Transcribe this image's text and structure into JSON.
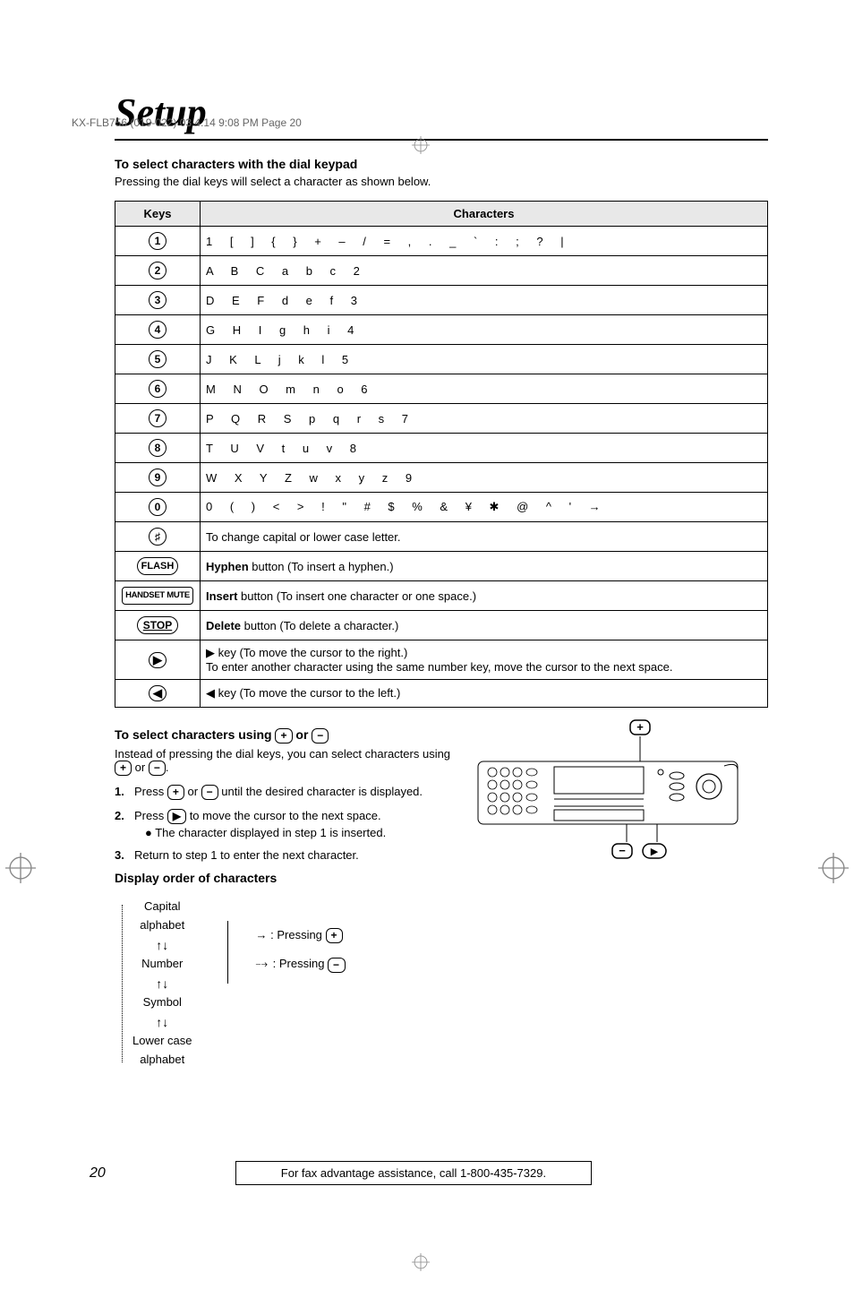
{
  "header": {
    "doc_id": "KX-FLB756 (019-022)  03.4.14  9:08 PM  Page 20"
  },
  "title": "Setup",
  "keypad_section": {
    "heading": "To select characters with the dial keypad",
    "subtext": "Pressing the dial keys will select a character as shown below.",
    "col_keys": "Keys",
    "col_chars": "Characters",
    "rows": [
      {
        "key": "1",
        "chars": "1 [ ] { } + – / = , . _ ` : ; ? |"
      },
      {
        "key": "2",
        "chars": "A B C a b c 2"
      },
      {
        "key": "3",
        "chars": "D E F d e f 3"
      },
      {
        "key": "4",
        "chars": "G H I g h i 4"
      },
      {
        "key": "5",
        "chars": "J K L j k l 5"
      },
      {
        "key": "6",
        "chars": "M N O m n o 6"
      },
      {
        "key": "7",
        "chars": "P Q R S p q r s 7"
      },
      {
        "key": "8",
        "chars": "T U V t u v 8"
      },
      {
        "key": "9",
        "chars": "W X Y Z w x y z 9"
      },
      {
        "key": "0",
        "chars": "0 ( ) < > ! \" # $ % & ¥ ✱ @ ^ ' →"
      }
    ],
    "hash_desc": "To change capital or lower case letter.",
    "flash_label": "FLASH",
    "flash_desc_bold": "Hyphen",
    "flash_desc_rest": " button (To insert a hyphen.)",
    "handset_label": "HANDSET MUTE",
    "handset_desc_bold": "Insert",
    "handset_desc_rest": " button (To insert one character or one space.)",
    "stop_label": "STOP",
    "stop_desc_bold": "Delete",
    "stop_desc_rest": " button (To delete a character.)",
    "right_desc_line1": "▶ key (To move the cursor to the right.)",
    "right_desc_line2": "To enter another character using the same number key, move the cursor to the next space.",
    "left_desc": "◀ key (To move the cursor to the left.)"
  },
  "plusminus_section": {
    "heading_prefix": "To select characters using ",
    "heading_mid": " or ",
    "intro_prefix": "Instead of pressing the dial keys, you can select characters using ",
    "intro_mid": " or ",
    "intro_end": ".",
    "steps": {
      "s1_num": "1.",
      "s1_text_a": "Press ",
      "s1_text_b": " or ",
      "s1_text_c": " until the desired character is displayed.",
      "s2_num": "2.",
      "s2_text_a": "Press ",
      "s2_text_b": " to move the cursor to the next space.",
      "s2_bullet": "● The character displayed in step 1 is inserted.",
      "s3_num": "3.",
      "s3_text": "Return to step 1 to enter the next character."
    }
  },
  "order_section": {
    "heading": "Display order of characters",
    "items": {
      "capital": "Capital\nalphabet",
      "number": "Number",
      "symbol": "Symbol",
      "lower": "Lower case\nalphabet"
    },
    "legend_plus_prefix": ": Pressing ",
    "legend_minus_prefix": ": Pressing "
  },
  "footer": {
    "page_num": "20",
    "assist": "For fax advantage assistance, call 1-800-435-7329."
  }
}
